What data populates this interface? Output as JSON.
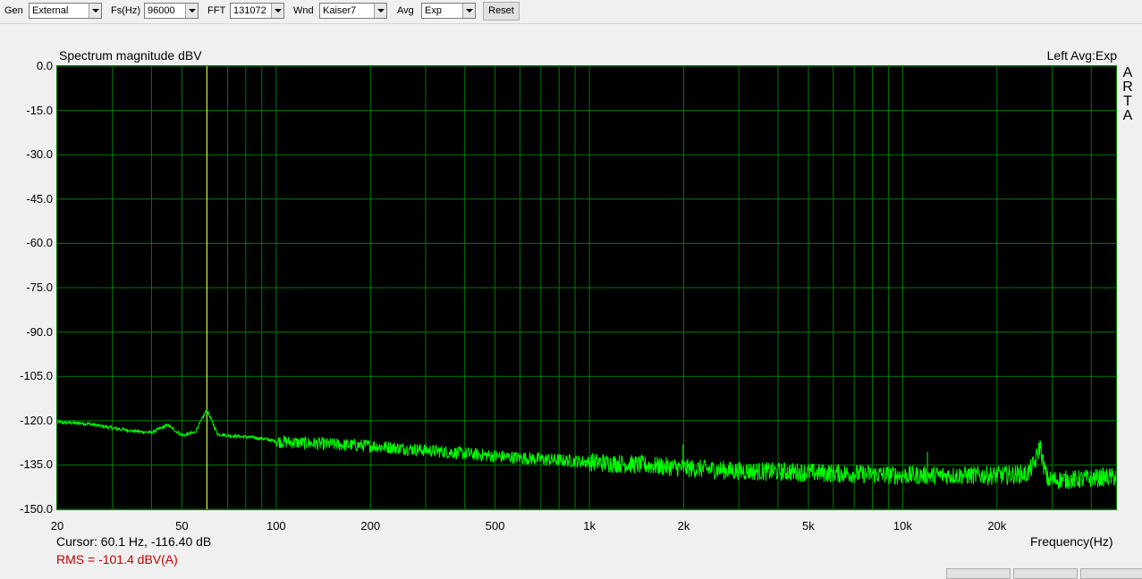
{
  "toolbar": {
    "gen_label": "Gen",
    "gen_value": "External",
    "fs_label": "Fs(Hz)",
    "fs_value": "96000",
    "fft_label": "FFT",
    "fft_value": "131072",
    "wnd_label": "Wnd",
    "wnd_value": "Kaiser7",
    "avg_label": "Avg",
    "avg_value": "Exp",
    "reset_label": "Reset"
  },
  "chart": {
    "title": "Spectrum magnitude dBV",
    "channel_info": "Left  Avg:Exp",
    "brand_letters": [
      "A",
      "R",
      "T",
      "A"
    ],
    "xlabel": "Frequency(Hz)",
    "cursor_text": "Cursor:   60.1 Hz, -116.40 dB",
    "rms_text": "RMS = -101.4 dBV(A)"
  },
  "colors": {
    "trace": "#00ff00",
    "grid": "#007a00",
    "cursor": "#ffff60",
    "background": "#000000",
    "rms": "#c00000"
  },
  "chart_data": {
    "type": "line",
    "xscale": "log",
    "xlim": [
      20,
      48000
    ],
    "ylim": [
      -150,
      0
    ],
    "x_ticks": [
      {
        "value": 20,
        "label": "20"
      },
      {
        "value": 50,
        "label": "50"
      },
      {
        "value": 100,
        "label": "100"
      },
      {
        "value": 200,
        "label": "200"
      },
      {
        "value": 500,
        "label": "500"
      },
      {
        "value": 1000,
        "label": "1k"
      },
      {
        "value": 2000,
        "label": "2k"
      },
      {
        "value": 5000,
        "label": "5k"
      },
      {
        "value": 10000,
        "label": "10k"
      },
      {
        "value": 20000,
        "label": "20k"
      }
    ],
    "y_ticks": [
      "0.0",
      "-15.0",
      "-30.0",
      "-45.0",
      "-60.0",
      "-75.0",
      "-90.0",
      "-105.0",
      "-120.0",
      "-135.0",
      "-150.0"
    ],
    "cursor_x": 60.1,
    "series": [
      {
        "x": [
          20,
          25,
          30,
          35,
          40,
          45,
          50,
          55,
          60.1,
          65,
          70,
          80,
          90,
          100,
          120,
          150,
          200,
          300,
          500,
          700,
          1000,
          1500,
          2000,
          3000,
          5000,
          7000,
          10000,
          15000,
          20000,
          25000,
          26500,
          27500,
          28000,
          29000,
          31000,
          35000,
          40000,
          48000
        ],
        "y": [
          -120.5,
          -121,
          -122.5,
          -123.5,
          -124,
          -121.5,
          -125,
          -124,
          -116.4,
          -124.5,
          -125,
          -125.5,
          -126,
          -127,
          -127.5,
          -128,
          -128.5,
          -130,
          -132,
          -133,
          -134,
          -135,
          -136,
          -137,
          -137.5,
          -138,
          -138.5,
          -138.5,
          -138.5,
          -138,
          -134,
          -128,
          -134,
          -140,
          -140,
          -140,
          -139.5,
          -139
        ]
      }
    ]
  }
}
